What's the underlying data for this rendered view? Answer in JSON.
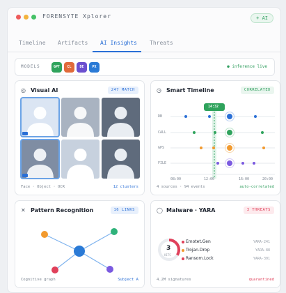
{
  "window": {
    "title": "FORENSYTE Xplorer",
    "ai_button": "+ AI"
  },
  "tabs": [
    {
      "label": "Timeline",
      "active": false
    },
    {
      "label": "Artifacts",
      "active": false
    },
    {
      "label": "AI Insights",
      "active": true
    },
    {
      "label": "Threats",
      "active": false
    }
  ],
  "models": {
    "label": "MODELS",
    "chips": [
      {
        "text": "GPT",
        "color": "#2fa35c"
      },
      {
        "text": "CL",
        "color": "#e06a3a"
      },
      {
        "text": "DE",
        "color": "#6b4fcf"
      },
      {
        "text": "PX",
        "color": "#2a7ad6"
      }
    ],
    "status": "● inference live"
  },
  "visual_ai": {
    "title": "Visual AI",
    "badge": "247 MATCH",
    "footer_left": "Face · Object · OCR",
    "footer_right": "12 clusters",
    "icon": "target-icon"
  },
  "smart_timeline": {
    "title": "Smart Timeline",
    "badge": "CORRELATED",
    "marker": "14:32",
    "rows": [
      "DB",
      "CALL",
      "GPS",
      "FILE"
    ],
    "ticks": [
      "08:00",
      "12:00",
      "16:00",
      "20:00"
    ],
    "footer_left": "4 sources · 94 events",
    "footer_right": "auto-correlated",
    "icon": "clock-icon"
  },
  "pattern": {
    "title": "Pattern Recognition",
    "badge": "16 LINKS",
    "footer_left": "Cognitive graph",
    "footer_right": "Subject A",
    "icon": "cross-icon"
  },
  "malware": {
    "title": "Malware · YARA",
    "badge": "3 THREATS",
    "ring_value": "3",
    "ring_label": "HITS",
    "threats": [
      {
        "name": "Emotet.Gen",
        "hash": "YARA-241",
        "color": "#e0405a"
      },
      {
        "name": "Trojan.Drop",
        "hash": "YARA-88",
        "color": "#f29a2e"
      },
      {
        "name": "Ransom.Lock",
        "hash": "YARA-301",
        "color": "#e0405a"
      }
    ],
    "footer_left": "4.2M signatures",
    "footer_right": "quarantined",
    "icon": "shield-icon"
  },
  "colors": {
    "accent_blue": "#2a6fd6",
    "accent_green": "#2f9e5e",
    "danger_red": "#e0405a",
    "warning_orange": "#f29a2e",
    "purple": "#7b5ae0"
  }
}
